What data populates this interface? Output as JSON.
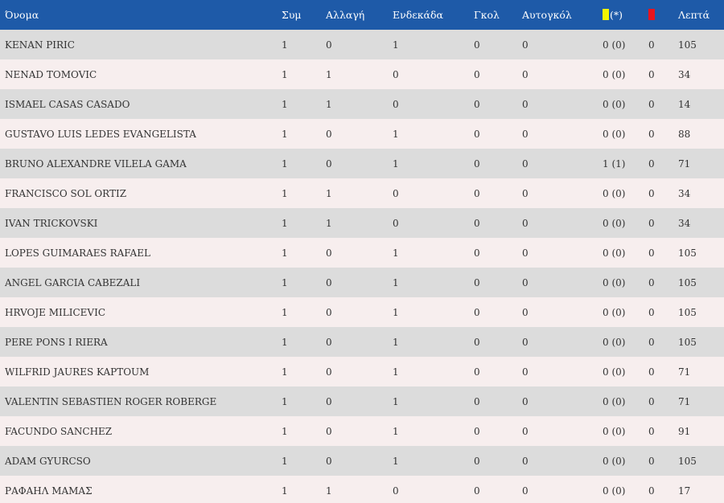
{
  "colors": {
    "header_bg": "#1e5aa8",
    "row_odd": "#dcdcdc",
    "row_even": "#f7eeee",
    "yellow_card": "#f5f500",
    "red_card": "#e8141e"
  },
  "header": {
    "name": "Όνομα",
    "apps": "Συμ",
    "sub": "Αλλαγή",
    "lineup": "Ενδεκάδα",
    "goals": "Γκολ",
    "own_goals": "Αυτογκόλ",
    "yellow_icon": "yellow-card-icon",
    "yellow_suffix": "(*)",
    "red_icon": "red-card-icon",
    "minutes": "Λεπτά"
  },
  "rows": [
    {
      "name": "KENAN PIRIC",
      "apps": "1",
      "sub": "0",
      "lineup": "1",
      "goals": "0",
      "own_goals": "0",
      "yellow": "0 (0)",
      "red": "0",
      "minutes": "105"
    },
    {
      "name": "NENAD TOMOVIC",
      "apps": "1",
      "sub": "1",
      "lineup": "0",
      "goals": "0",
      "own_goals": "0",
      "yellow": "0 (0)",
      "red": "0",
      "minutes": "34"
    },
    {
      "name": "ISMAEL CASAS CASADO",
      "apps": "1",
      "sub": "1",
      "lineup": "0",
      "goals": "0",
      "own_goals": "0",
      "yellow": "0 (0)",
      "red": "0",
      "minutes": "14"
    },
    {
      "name": "GUSTAVO LUIS LEDES EVANGELISTA",
      "apps": "1",
      "sub": "0",
      "lineup": "1",
      "goals": "0",
      "own_goals": "0",
      "yellow": "0 (0)",
      "red": "0",
      "minutes": "88"
    },
    {
      "name": "BRUNO ALEXANDRE VILELA GAMA",
      "apps": "1",
      "sub": "0",
      "lineup": "1",
      "goals": "0",
      "own_goals": "0",
      "yellow": "1 (1)",
      "red": "0",
      "minutes": "71"
    },
    {
      "name": "FRANCISCO SOL ORTIZ",
      "apps": "1",
      "sub": "1",
      "lineup": "0",
      "goals": "0",
      "own_goals": "0",
      "yellow": "0 (0)",
      "red": "0",
      "minutes": "34"
    },
    {
      "name": "IVAN TRICKOVSKI",
      "apps": "1",
      "sub": "1",
      "lineup": "0",
      "goals": "0",
      "own_goals": "0",
      "yellow": "0 (0)",
      "red": "0",
      "minutes": "34"
    },
    {
      "name": "LOPES GUIMARAES RAFAEL",
      "apps": "1",
      "sub": "0",
      "lineup": "1",
      "goals": "0",
      "own_goals": "0",
      "yellow": "0 (0)",
      "red": "0",
      "minutes": "105"
    },
    {
      "name": "ANGEL GARCIA CABEZALI",
      "apps": "1",
      "sub": "0",
      "lineup": "1",
      "goals": "0",
      "own_goals": "0",
      "yellow": "0 (0)",
      "red": "0",
      "minutes": "105"
    },
    {
      "name": "HRVOJE MILICEVIC",
      "apps": "1",
      "sub": "0",
      "lineup": "1",
      "goals": "0",
      "own_goals": "0",
      "yellow": "0 (0)",
      "red": "0",
      "minutes": "105"
    },
    {
      "name": "PERE PONS I RIERA",
      "apps": "1",
      "sub": "0",
      "lineup": "1",
      "goals": "0",
      "own_goals": "0",
      "yellow": "0 (0)",
      "red": "0",
      "minutes": "105"
    },
    {
      "name": "WILFRID JAURES KAPTOUM",
      "apps": "1",
      "sub": "0",
      "lineup": "1",
      "goals": "0",
      "own_goals": "0",
      "yellow": "0 (0)",
      "red": "0",
      "minutes": "71"
    },
    {
      "name": "VALENTIN SEBASTIEN ROGER ROBERGE",
      "apps": "1",
      "sub": "0",
      "lineup": "1",
      "goals": "0",
      "own_goals": "0",
      "yellow": "0 (0)",
      "red": "0",
      "minutes": "71"
    },
    {
      "name": "FACUNDO SANCHEZ",
      "apps": "1",
      "sub": "0",
      "lineup": "1",
      "goals": "0",
      "own_goals": "0",
      "yellow": "0 (0)",
      "red": "0",
      "minutes": "91"
    },
    {
      "name": "ADAM GYURCSO",
      "apps": "1",
      "sub": "0",
      "lineup": "1",
      "goals": "0",
      "own_goals": "0",
      "yellow": "0 (0)",
      "red": "0",
      "minutes": "105"
    },
    {
      "name": "ΡΑΦΑΗΛ ΜΑΜΑΣ",
      "apps": "1",
      "sub": "1",
      "lineup": "0",
      "goals": "0",
      "own_goals": "0",
      "yellow": "0 (0)",
      "red": "0",
      "minutes": "17"
    }
  ]
}
